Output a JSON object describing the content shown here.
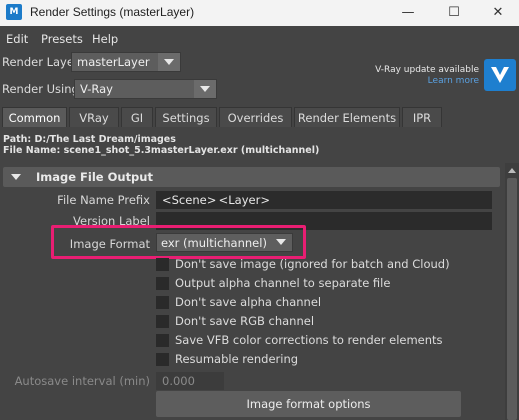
{
  "window": {
    "title": "Render Settings (masterLayer)",
    "app_icon": "maya-icon",
    "controls": [
      "minimize-icon",
      "maximize-icon",
      "close-icon"
    ]
  },
  "menu": [
    "Edit",
    "Presets",
    "Help"
  ],
  "render_layer": {
    "label": "Render Layer",
    "value": "masterLayer"
  },
  "render_using": {
    "label": "Render Using",
    "value": "V-Ray"
  },
  "vray_notice": {
    "line1": "V-Ray update available",
    "link": "Learn more"
  },
  "tabs": [
    "Common",
    "VRay",
    "GI",
    "Settings",
    "Overrides",
    "Render Elements",
    "IPR"
  ],
  "active_tab": "Common",
  "path_info": {
    "path": "Path: D:/The Last Dream/images",
    "file_name": "File Name: scene1_shot_5.3masterLayer.exr (multichannel)"
  },
  "section": {
    "title": "Image File Output",
    "file_name_prefix": {
      "label": "File Name Prefix",
      "value": "<Scene> <Layer>"
    },
    "version_label": {
      "label": "Version Label",
      "value": ""
    },
    "image_format": {
      "label": "Image Format",
      "value": "exr (multichannel)"
    },
    "options": [
      "Don't save image (ignored for batch and Cloud)",
      "Output alpha channel to separate file",
      "Don't save alpha channel",
      "Don't save RGB channel",
      "Save VFB color corrections to render elements",
      "Resumable rendering"
    ],
    "autosave": {
      "label": "Autosave interval (min)",
      "value": "0.000"
    },
    "button": "Image format options"
  },
  "colors": {
    "highlight": "#e91e73",
    "vray_blue": "#1e7fcf"
  }
}
